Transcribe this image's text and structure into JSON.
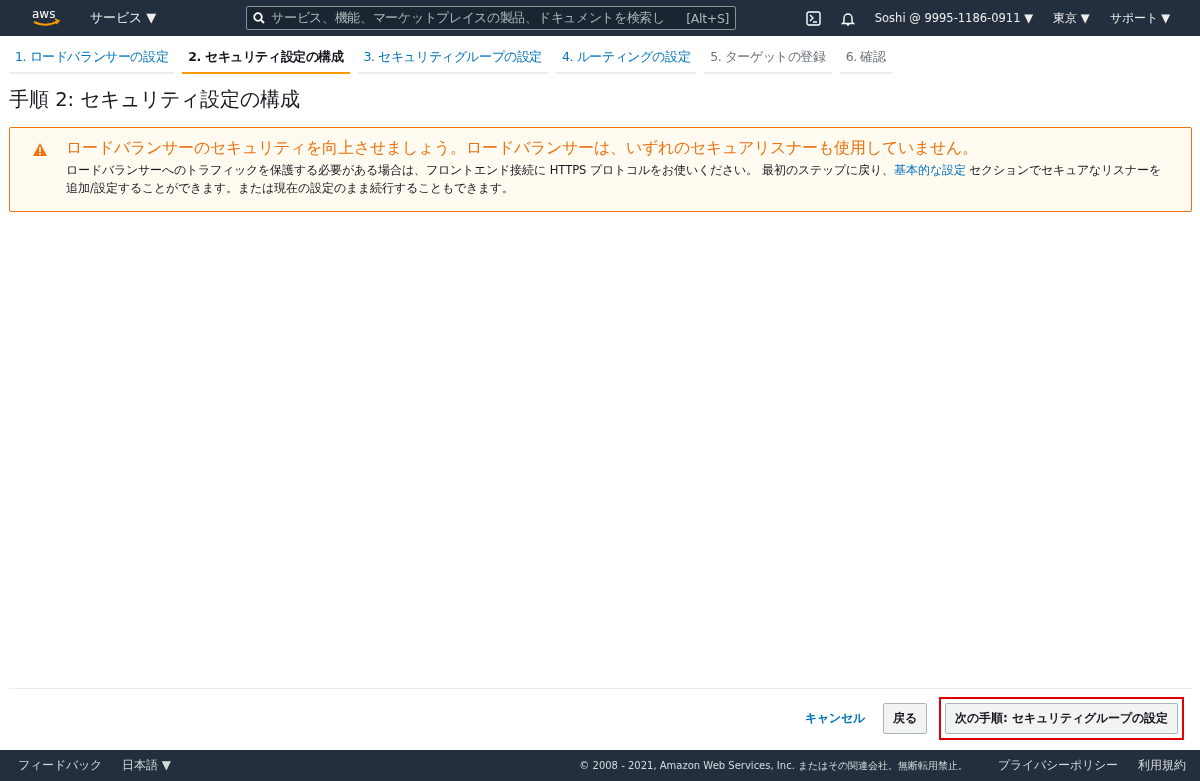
{
  "nav": {
    "logo": "aws",
    "services": "サービス ▼",
    "search": {
      "placeholder": "サービス、機能、マーケットプレイスの製品、ドキュメントを検索し",
      "shortcut": "[Alt+S]"
    },
    "account": "Soshi @ 9995-1186-0911 ▼",
    "region": "東京 ▼",
    "support": "サポート ▼"
  },
  "steps": [
    {
      "label": "1. ロードバランサーの設定",
      "selected": false,
      "disabled": false
    },
    {
      "label": "2. セキュリティ設定の構成",
      "selected": true,
      "disabled": false
    },
    {
      "label": "3. セキュリティグループの設定",
      "selected": false,
      "disabled": false
    },
    {
      "label": "4. ルーティングの設定",
      "selected": false,
      "disabled": false
    },
    {
      "label": "5. ターゲットの登録",
      "selected": false,
      "disabled": true
    },
    {
      "label": "6. 確認",
      "selected": false,
      "disabled": true
    }
  ],
  "page_title": "手順 2: セキュリティ設定の構成",
  "alert": {
    "title": "ロードバランサーのセキュリティを向上させましょう。ロードバランサーは、いずれのセキュアリスナーも使用していません。",
    "text_before": "ロードバランサーへのトラフィックを保護する必要がある場合は、フロントエンド接続に HTTPS プロトコルをお使いください。 最初のステップに戻り、",
    "link": "基本的な設定",
    "text_after": " セクションでセキュアなリスナーを追加/設定することができます。または現在の設定のまま続行することもできます。"
  },
  "actions": {
    "cancel": "キャンセル",
    "back": "戻る",
    "next": {
      "label": "次の手順: セキュリティグループの設定",
      "highlighted": true
    }
  },
  "footer": {
    "feedback": "フィードバック",
    "language": "日本語 ▼",
    "copyright": "© 2008 - 2021, Amazon Web Services, Inc. またはその関連会社。無断転用禁止。",
    "privacy": "プライバシーポリシー",
    "terms": "利用規約"
  }
}
